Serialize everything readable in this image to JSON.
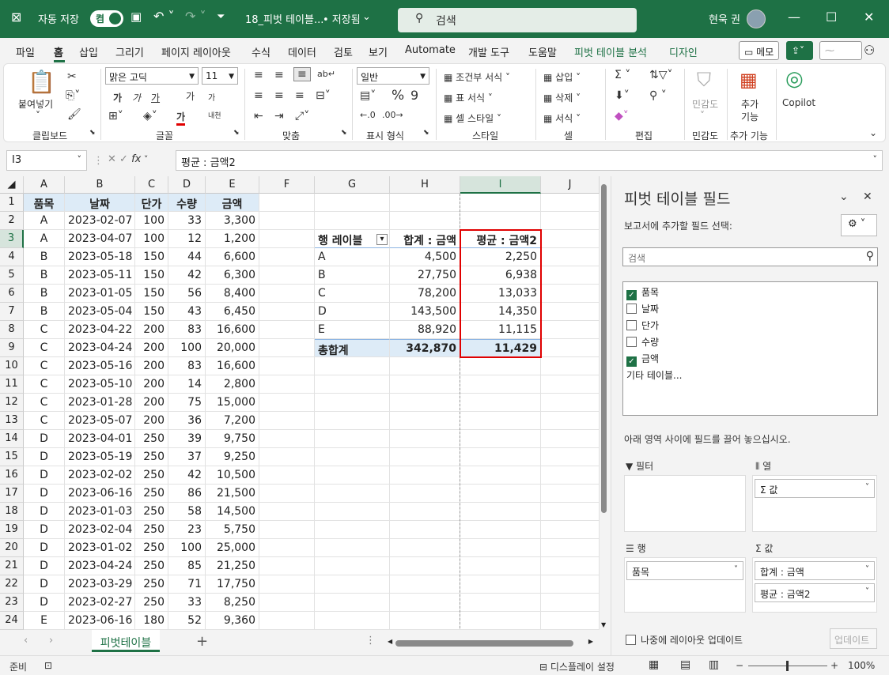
{
  "titlebar": {
    "autosave_label": "자동 저장",
    "toggle_state": "켬",
    "file_name": "18_피벗 테이블...",
    "saved_status": "• 저장됨",
    "search_placeholder": "검색",
    "user_name": "현욱 권"
  },
  "menu": {
    "items": [
      "파일",
      "홈",
      "삽입",
      "그리기",
      "페이지 레이아웃",
      "수식",
      "데이터",
      "검토",
      "보기",
      "Automate",
      "개발 도구",
      "도움말",
      "피벗 테이블 분석",
      "디자인"
    ],
    "active": "홈",
    "memo_label": "메모"
  },
  "ribbon": {
    "clipboard": {
      "paste_label": "붙여넣기",
      "group_label": "클립보드"
    },
    "font": {
      "font_name": "맑은 고딕",
      "font_size": "11",
      "group_label": "글꼴",
      "bold": "가",
      "italic": "가",
      "underline": "가",
      "grow": "가",
      "shrink": "가",
      "font_color": "가",
      "phonetic": "내천"
    },
    "alignment": {
      "group_label": "맞춤"
    },
    "number": {
      "format": "일반",
      "group_label": "표시 형식"
    },
    "styles": {
      "cond_format": "조건부 서식",
      "table_format": "표 서식",
      "cell_style": "셀 스타일",
      "group_label": "스타일"
    },
    "cells": {
      "insert": "삽입",
      "delete": "삭제",
      "format": "서식",
      "group_label": "셀"
    },
    "editing": {
      "group_label": "편집"
    },
    "sensitivity": {
      "label": "민감도",
      "group_label": "민감도"
    },
    "addins": {
      "label_line1": "추가",
      "label_line2": "기능",
      "group_label": "추가 기능"
    },
    "copilot": {
      "label": "Copilot"
    }
  },
  "formula_bar": {
    "name_box": "I3",
    "formula": "평균 : 금액2",
    "fx": "fx"
  },
  "columns": [
    "A",
    "B",
    "C",
    "D",
    "E",
    "F",
    "G",
    "H",
    "I",
    "J"
  ],
  "rows": [
    1,
    2,
    3,
    4,
    5,
    6,
    7,
    8,
    9,
    10,
    11,
    12,
    13,
    14,
    15,
    16,
    17,
    18,
    19,
    20,
    21,
    22,
    23,
    24
  ],
  "table": {
    "headers": [
      "품목",
      "날짜",
      "단가",
      "수량",
      "금액"
    ],
    "rows": [
      [
        "A",
        "2023-02-07",
        "100",
        "33",
        "3,300"
      ],
      [
        "A",
        "2023-04-07",
        "100",
        "12",
        "1,200"
      ],
      [
        "B",
        "2023-05-18",
        "150",
        "44",
        "6,600"
      ],
      [
        "B",
        "2023-05-11",
        "150",
        "42",
        "6,300"
      ],
      [
        "B",
        "2023-01-05",
        "150",
        "56",
        "8,400"
      ],
      [
        "B",
        "2023-05-04",
        "150",
        "43",
        "6,450"
      ],
      [
        "C",
        "2023-04-22",
        "200",
        "83",
        "16,600"
      ],
      [
        "C",
        "2023-04-24",
        "200",
        "100",
        "20,000"
      ],
      [
        "C",
        "2023-05-16",
        "200",
        "83",
        "16,600"
      ],
      [
        "C",
        "2023-05-10",
        "200",
        "14",
        "2,800"
      ],
      [
        "C",
        "2023-01-28",
        "200",
        "75",
        "15,000"
      ],
      [
        "C",
        "2023-05-07",
        "200",
        "36",
        "7,200"
      ],
      [
        "D",
        "2023-04-01",
        "250",
        "39",
        "9,750"
      ],
      [
        "D",
        "2023-05-19",
        "250",
        "37",
        "9,250"
      ],
      [
        "D",
        "2023-02-02",
        "250",
        "42",
        "10,500"
      ],
      [
        "D",
        "2023-06-16",
        "250",
        "86",
        "21,500"
      ],
      [
        "D",
        "2023-01-03",
        "250",
        "58",
        "14,500"
      ],
      [
        "D",
        "2023-02-04",
        "250",
        "23",
        "5,750"
      ],
      [
        "D",
        "2023-01-02",
        "250",
        "100",
        "25,000"
      ],
      [
        "D",
        "2023-04-24",
        "250",
        "85",
        "21,250"
      ],
      [
        "D",
        "2023-03-29",
        "250",
        "71",
        "17,750"
      ],
      [
        "D",
        "2023-02-27",
        "250",
        "33",
        "8,250"
      ],
      [
        "E",
        "2023-06-16",
        "180",
        "52",
        "9,360"
      ]
    ]
  },
  "pivot": {
    "headers": [
      "행 레이블",
      "합계 : 금액",
      "평균 : 금액2"
    ],
    "rows": [
      [
        "A",
        "4,500",
        "2,250"
      ],
      [
        "B",
        "27,750",
        "6,938"
      ],
      [
        "C",
        "78,200",
        "13,033"
      ],
      [
        "D",
        "143,500",
        "14,350"
      ],
      [
        "E",
        "88,920",
        "11,115"
      ]
    ],
    "total": [
      "총합계",
      "342,870",
      "11,429"
    ]
  },
  "sheet_tabs": {
    "active": "피벗테이블"
  },
  "status": {
    "ready": "준비",
    "display_settings": "디스플레이 설정",
    "zoom": "100%"
  },
  "pane": {
    "title": "피벗 테이블 필드",
    "choose_label": "보고서에 추가할 필드 선택:",
    "search_placeholder": "검색",
    "fields": [
      {
        "name": "품목",
        "checked": true
      },
      {
        "name": "날짜",
        "checked": false
      },
      {
        "name": "단가",
        "checked": false
      },
      {
        "name": "수량",
        "checked": false
      },
      {
        "name": "금액",
        "checked": true
      }
    ],
    "more_tables": "기타 테이블...",
    "drag_hint": "아래 영역 사이에 필드를 끌어 놓으십시오.",
    "areas": {
      "filter": "필터",
      "columns": "열",
      "rows": "행",
      "values": "값"
    },
    "columns_item": "Σ 값",
    "rows_item": "품목",
    "values_items": [
      "합계 : 금액",
      "평균 : 금액2"
    ],
    "defer_label": "나중에 레이아웃 업데이트",
    "update_label": "업데이트"
  }
}
